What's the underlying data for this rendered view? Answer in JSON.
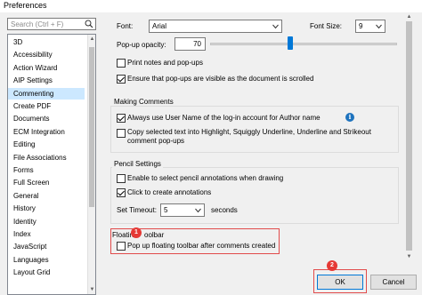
{
  "window": {
    "title": "Preferences"
  },
  "search": {
    "placeholder": "Search (Ctrl + F)"
  },
  "categories": {
    "items": [
      "3D",
      "Accessibility",
      "Action Wizard",
      "AIP Settings",
      "Commenting",
      "Create PDF",
      "Documents",
      "ECM Integration",
      "Editing",
      "File Associations",
      "Forms",
      "Full Screen",
      "General",
      "History",
      "Identity",
      "Index",
      "JavaScript",
      "Languages",
      "Layout Grid"
    ],
    "selected": "Commenting"
  },
  "viewing": {
    "font_label": "Font:",
    "font_value": "Arial",
    "font_size_label": "Font Size:",
    "font_size_value": "9",
    "opacity_label": "Pop-up opacity:",
    "opacity_value": "70",
    "opacity_percent": 70,
    "print_notes": {
      "label": "Print notes and pop-ups",
      "checked": false
    },
    "ensure_visible": {
      "label": "Ensure that pop-ups are visible as the document is scrolled",
      "checked": true
    }
  },
  "making_comments": {
    "title": "Making Comments",
    "use_name": {
      "label": "Always use User Name of the log-in account for Author name",
      "checked": true
    },
    "copy_text": {
      "label_line1": "Copy selected text into Highlight, Squiggly Underline, Underline and Strikeout",
      "label_line2": "comment pop-ups",
      "checked": false
    }
  },
  "pencil": {
    "title": "Pencil Settings",
    "enable_select": {
      "label": "Enable to select pencil annotations when drawing",
      "checked": false
    },
    "click_create": {
      "label": "Click to create annotations",
      "checked": true
    },
    "timeout_label": "Set Timeout:",
    "timeout_value": "5",
    "timeout_unit": "seconds"
  },
  "floating": {
    "title_part1": "Floatin",
    "title_part2": "oolbar",
    "popup_toolbar": {
      "label": "Pop up floating toolbar after comments created",
      "checked": false
    }
  },
  "annotations": {
    "badge1": "1",
    "badge2": "2"
  },
  "buttons": {
    "ok": "OK",
    "cancel": "Cancel"
  },
  "colors": {
    "accent": "#0078d7",
    "selection": "#cce8ff",
    "highlight_red": "#e14b4b",
    "badge_red": "#e53935",
    "info_blue": "#1e73be"
  }
}
